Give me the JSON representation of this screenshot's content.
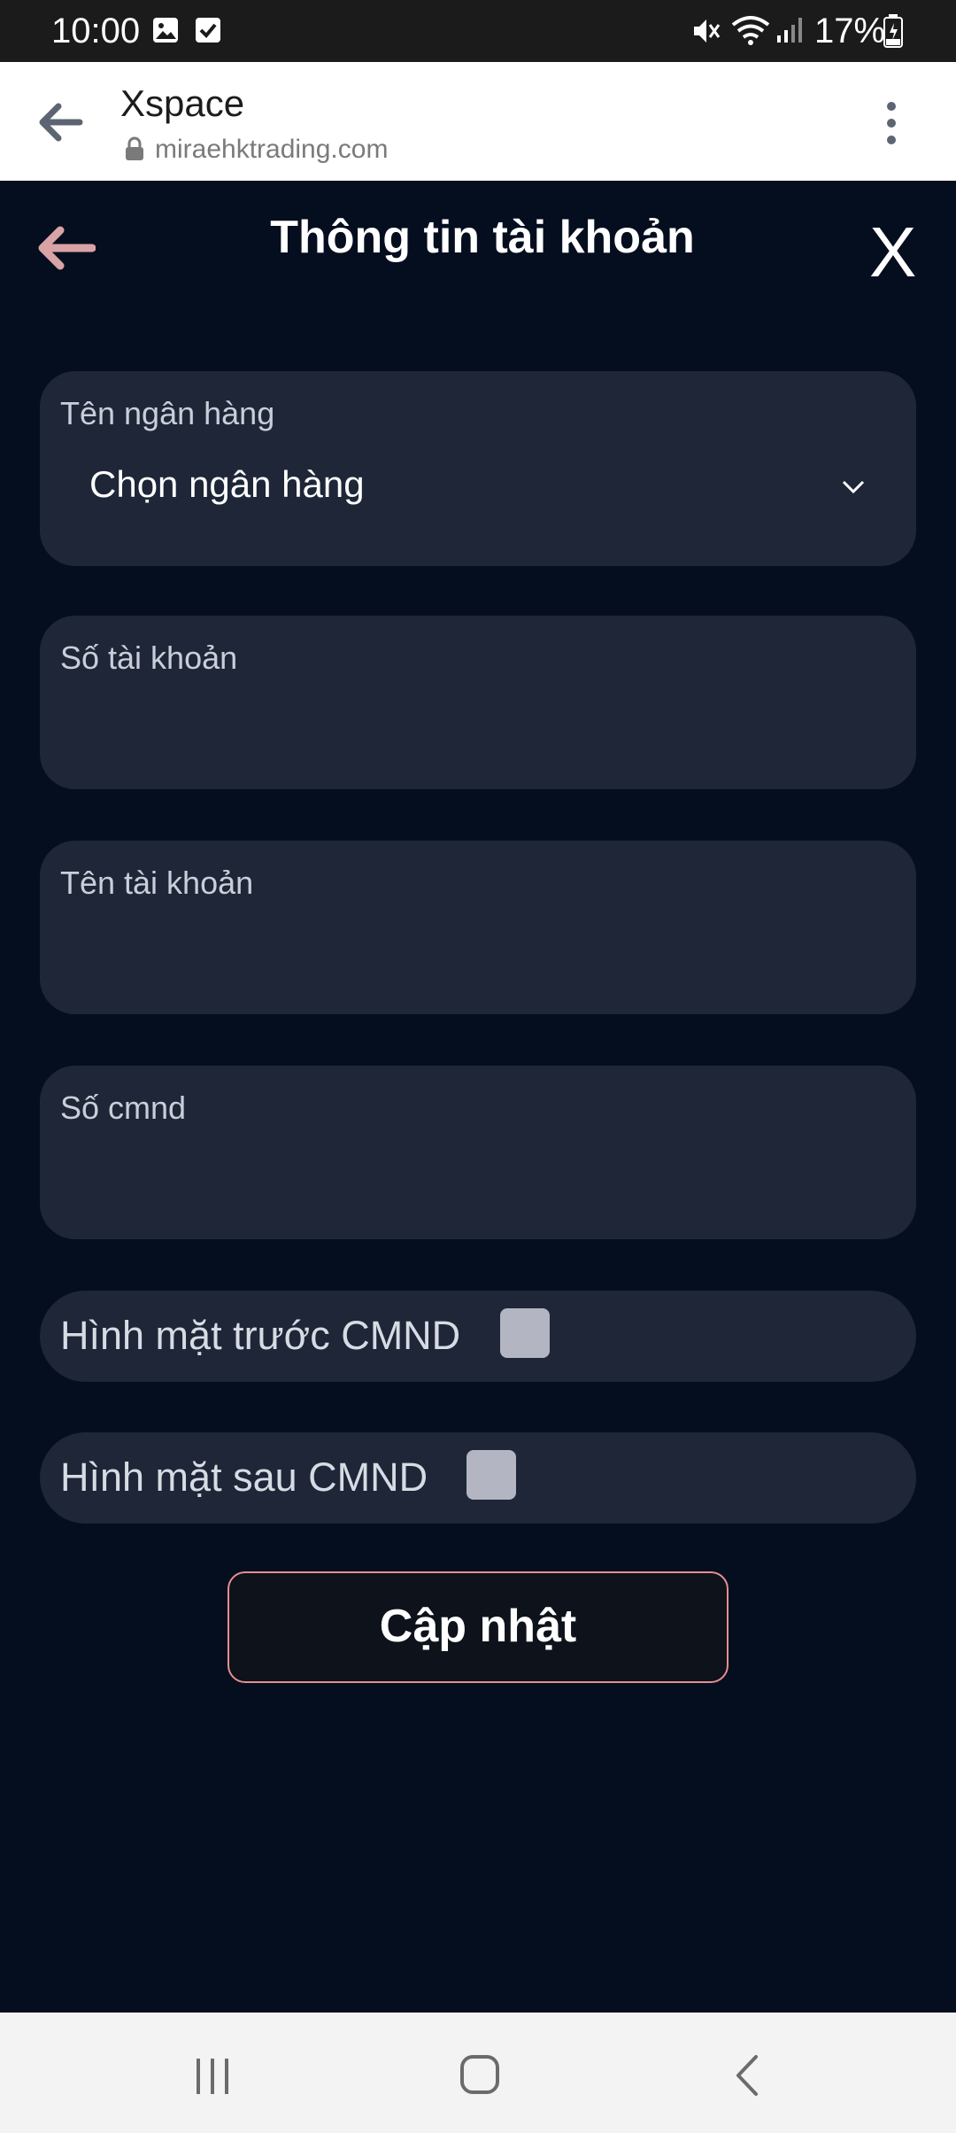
{
  "status_bar": {
    "time": "10:00",
    "battery": "17%",
    "icons": [
      "image-icon",
      "check-square-icon",
      "mute-icon",
      "wifi-icon",
      "signal-icon",
      "battery-icon"
    ]
  },
  "browser": {
    "title": "Xspace",
    "url": "miraehktrading.com",
    "icons": [
      "back-arrow-icon",
      "lock-icon",
      "more-vert-icon"
    ]
  },
  "header": {
    "title": "Thông tin tài khoản",
    "close": "X",
    "back_icon": "back-arrow-icon",
    "back_icon_color": "#d9a3a6"
  },
  "form": {
    "bank": {
      "label": "Tên ngân hàng",
      "value": "Chọn ngân hàng"
    },
    "account_number": {
      "label": "Số tài khoản",
      "value": ""
    },
    "account_name": {
      "label": "Tên tài khoản",
      "value": ""
    },
    "id_number": {
      "label": "Số cmnd",
      "value": ""
    },
    "id_front": {
      "label": "Hình mặt trước CMND"
    },
    "id_back": {
      "label": "Hình mặt sau CMND"
    },
    "submit": "Cập nhật"
  },
  "colors": {
    "background": "#050e1f",
    "card": "#1e2638",
    "button_border": "#e88d91",
    "checkbox": "#b3b6c2"
  },
  "nav_bar": {
    "icons": [
      "recent-apps-icon",
      "home-icon",
      "back-icon"
    ]
  }
}
